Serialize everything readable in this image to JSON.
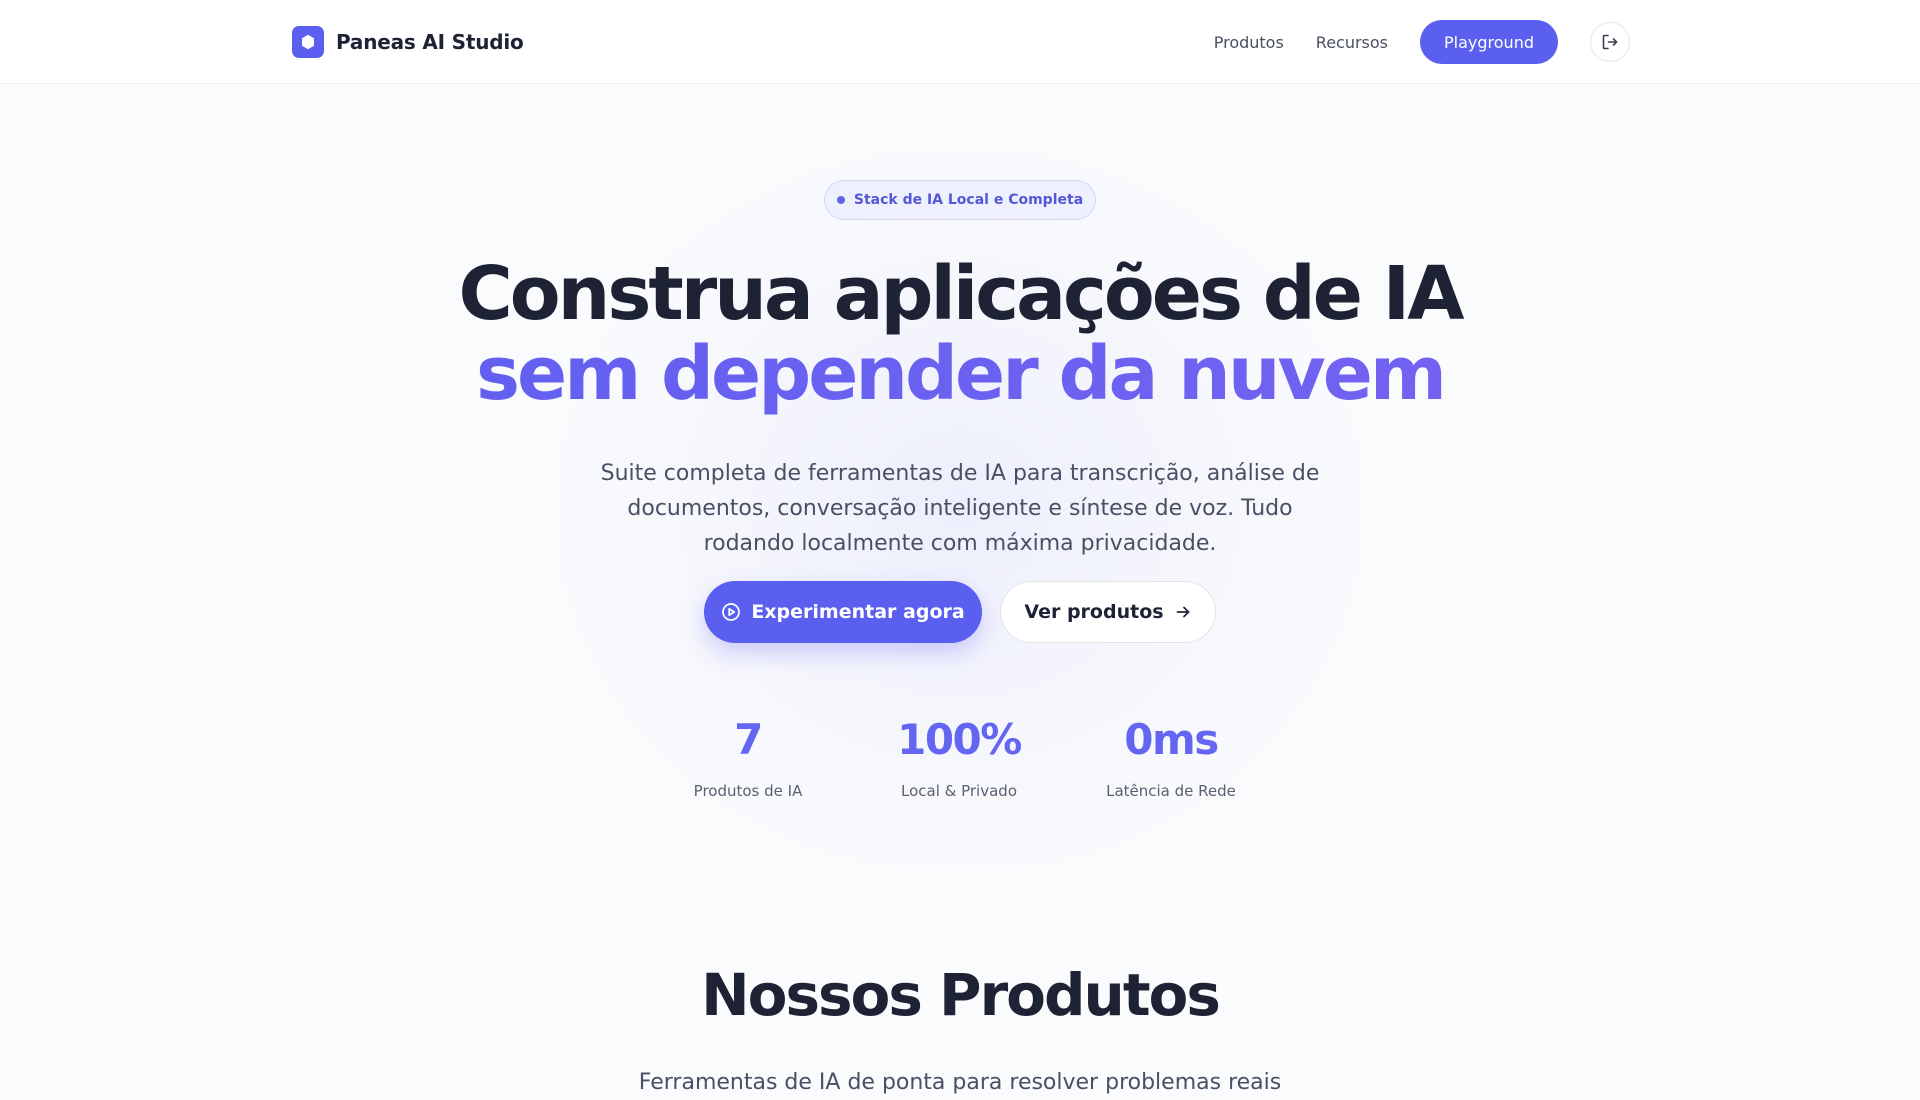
{
  "header": {
    "brand_name": "Paneas AI Studio",
    "brand_icon": "hexagon-logo-icon",
    "nav": {
      "products": "Produtos",
      "resources": "Recursos",
      "playground": "Playground",
      "logout_icon": "logout-icon"
    }
  },
  "hero": {
    "badge": "Stack de IA Local e Completa",
    "title_line1": "Construa aplicações de IA",
    "title_line2": "sem depender da nuvem",
    "subtitle": "Suite completa de ferramentas de IA para transcrição, análise de documentos, conversação inteligente e síntese de voz. Tudo rodando localmente com máxima privacidade.",
    "primary_button": "Experimentar agora",
    "primary_button_icon": "play-circle-icon",
    "secondary_button": "Ver produtos",
    "secondary_button_icon": "arrow-right-icon"
  },
  "stats": [
    {
      "value": "7",
      "label": "Produtos de IA"
    },
    {
      "value": "100%",
      "label": "Local & Privado"
    },
    {
      "value": "0ms",
      "label": "Latência de Rede"
    }
  ],
  "products_section": {
    "title": "Nossos Produtos",
    "subtitle": "Ferramentas de IA de ponta para resolver problemas reais"
  },
  "colors": {
    "accent": "#5b5ff0",
    "text_dark": "#1e2235",
    "text_muted": "#4a4f63"
  }
}
